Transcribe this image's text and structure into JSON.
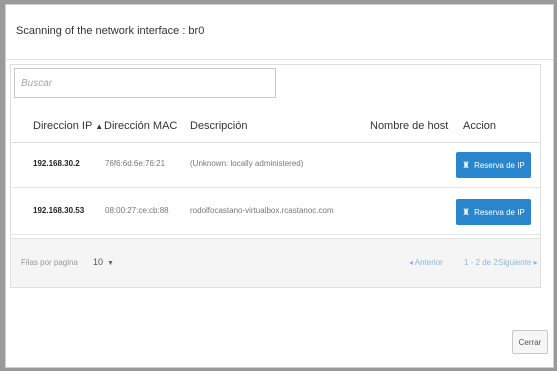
{
  "dialog": {
    "title": "Scanning of the network interface : br0",
    "close_label": "Cerrar"
  },
  "search": {
    "placeholder": "Buscar",
    "value": ""
  },
  "table": {
    "columns": [
      "Direccion IP",
      "Dirección MAC",
      "Descripción",
      "Nombre de host",
      "Accion"
    ],
    "sorted_column": "Direccion IP",
    "sort_direction": "ascending",
    "sort_icon": "caret-up-icon",
    "rows": [
      {
        "ip": "192.168.30.2",
        "mac": "76f6:6d:6e:76:21",
        "description": "(Unknown: locally administered)",
        "hostname": "",
        "action_label": "Reserva de IP"
      },
      {
        "ip": "192.168.30.53",
        "mac": "08:00:27:ce:cb:88",
        "description": "rodolfocastano-virtualbox.rcastanoc.com",
        "hostname": "",
        "action_label": "Reserva de IP"
      }
    ]
  },
  "pagination": {
    "rows_per_page_label": "Filas por pagina",
    "rows_per_page_value": "10",
    "prev_label": "Anterior",
    "range_label": "1 - 2 de 2",
    "next_label": "Siguiente"
  },
  "colors": {
    "accent": "#2a86cc",
    "pager_link": "#8fb8d8",
    "backdrop": "#9a9a9a"
  }
}
